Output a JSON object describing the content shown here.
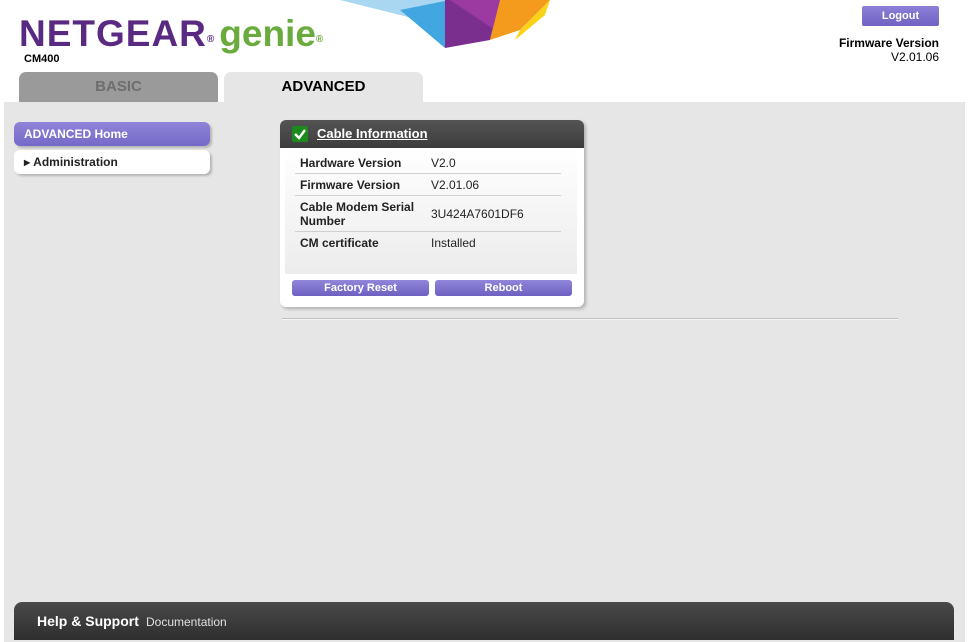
{
  "header": {
    "logo_brand": "NETGEAR",
    "logo_product": "genie",
    "registered_mark": "®",
    "model": "CM400",
    "logout_label": "Logout",
    "firmware_label": "Firmware Version",
    "firmware_value": "V2.01.06"
  },
  "tabs": [
    {
      "label": "BASIC",
      "active": false
    },
    {
      "label": "ADVANCED",
      "active": true
    }
  ],
  "sidebar": {
    "items": [
      {
        "label": "ADVANCED Home",
        "selected": true
      },
      {
        "label": "Administration",
        "selected": false,
        "expandable": true
      }
    ]
  },
  "panel": {
    "title": "Cable Information",
    "status_icon": "check-icon",
    "rows": [
      {
        "key": "Hardware Version",
        "value": "V2.0"
      },
      {
        "key": "Firmware Version",
        "value": "V2.01.06"
      },
      {
        "key": "Cable Modem Serial Number",
        "value": "3U424A7601DF6"
      },
      {
        "key": "CM certificate",
        "value": "Installed"
      }
    ],
    "buttons": {
      "factory_reset": "Factory Reset",
      "reboot": "Reboot"
    }
  },
  "footer": {
    "help": "Help & Support",
    "documentation": "Documentation"
  },
  "colors": {
    "brand_purple": "#5a2a82",
    "genie_green": "#6aab3e",
    "button_purple": "#7569c8",
    "status_green": "#1d8a1d"
  }
}
